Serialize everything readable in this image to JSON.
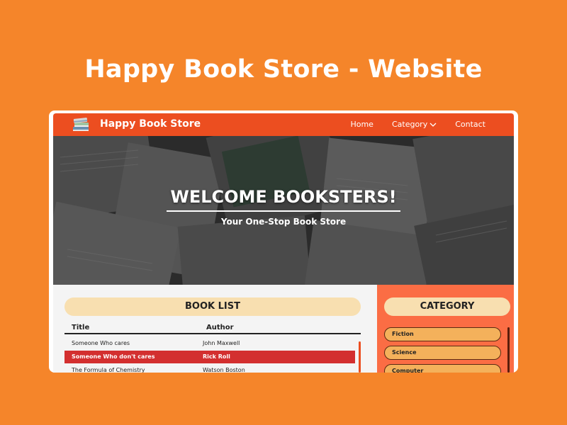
{
  "poster": {
    "title": "Happy Book Store - Website"
  },
  "navbar": {
    "brand": "Happy Book Store",
    "links": [
      {
        "label": "Home"
      },
      {
        "label": "Category"
      },
      {
        "label": "Contact"
      }
    ],
    "color": "#ec4e20"
  },
  "hero": {
    "title": "WELCOME BOOKSTERS!",
    "subtitle": "Your One-Stop Book Store"
  },
  "book_list": {
    "title": "BOOK LIST",
    "columns": [
      "Title",
      "Author"
    ],
    "rows": [
      {
        "title": "Someone Who cares",
        "author": "John Maxwell",
        "selected": false
      },
      {
        "title": "Someone Who don't cares",
        "author": "Rick Roll",
        "selected": true
      },
      {
        "title": "The Formula of Chemistry",
        "author": "Watson Boston",
        "selected": false
      }
    ]
  },
  "category": {
    "title": "CATEGORY",
    "items": [
      {
        "label": "Fiction"
      },
      {
        "label": "Science"
      },
      {
        "label": "Computer"
      }
    ],
    "color": "#fb6d44"
  },
  "colors": {
    "background": "#f5852a",
    "selected_row": "#d32f2f",
    "pill": "#f8dfb0"
  }
}
